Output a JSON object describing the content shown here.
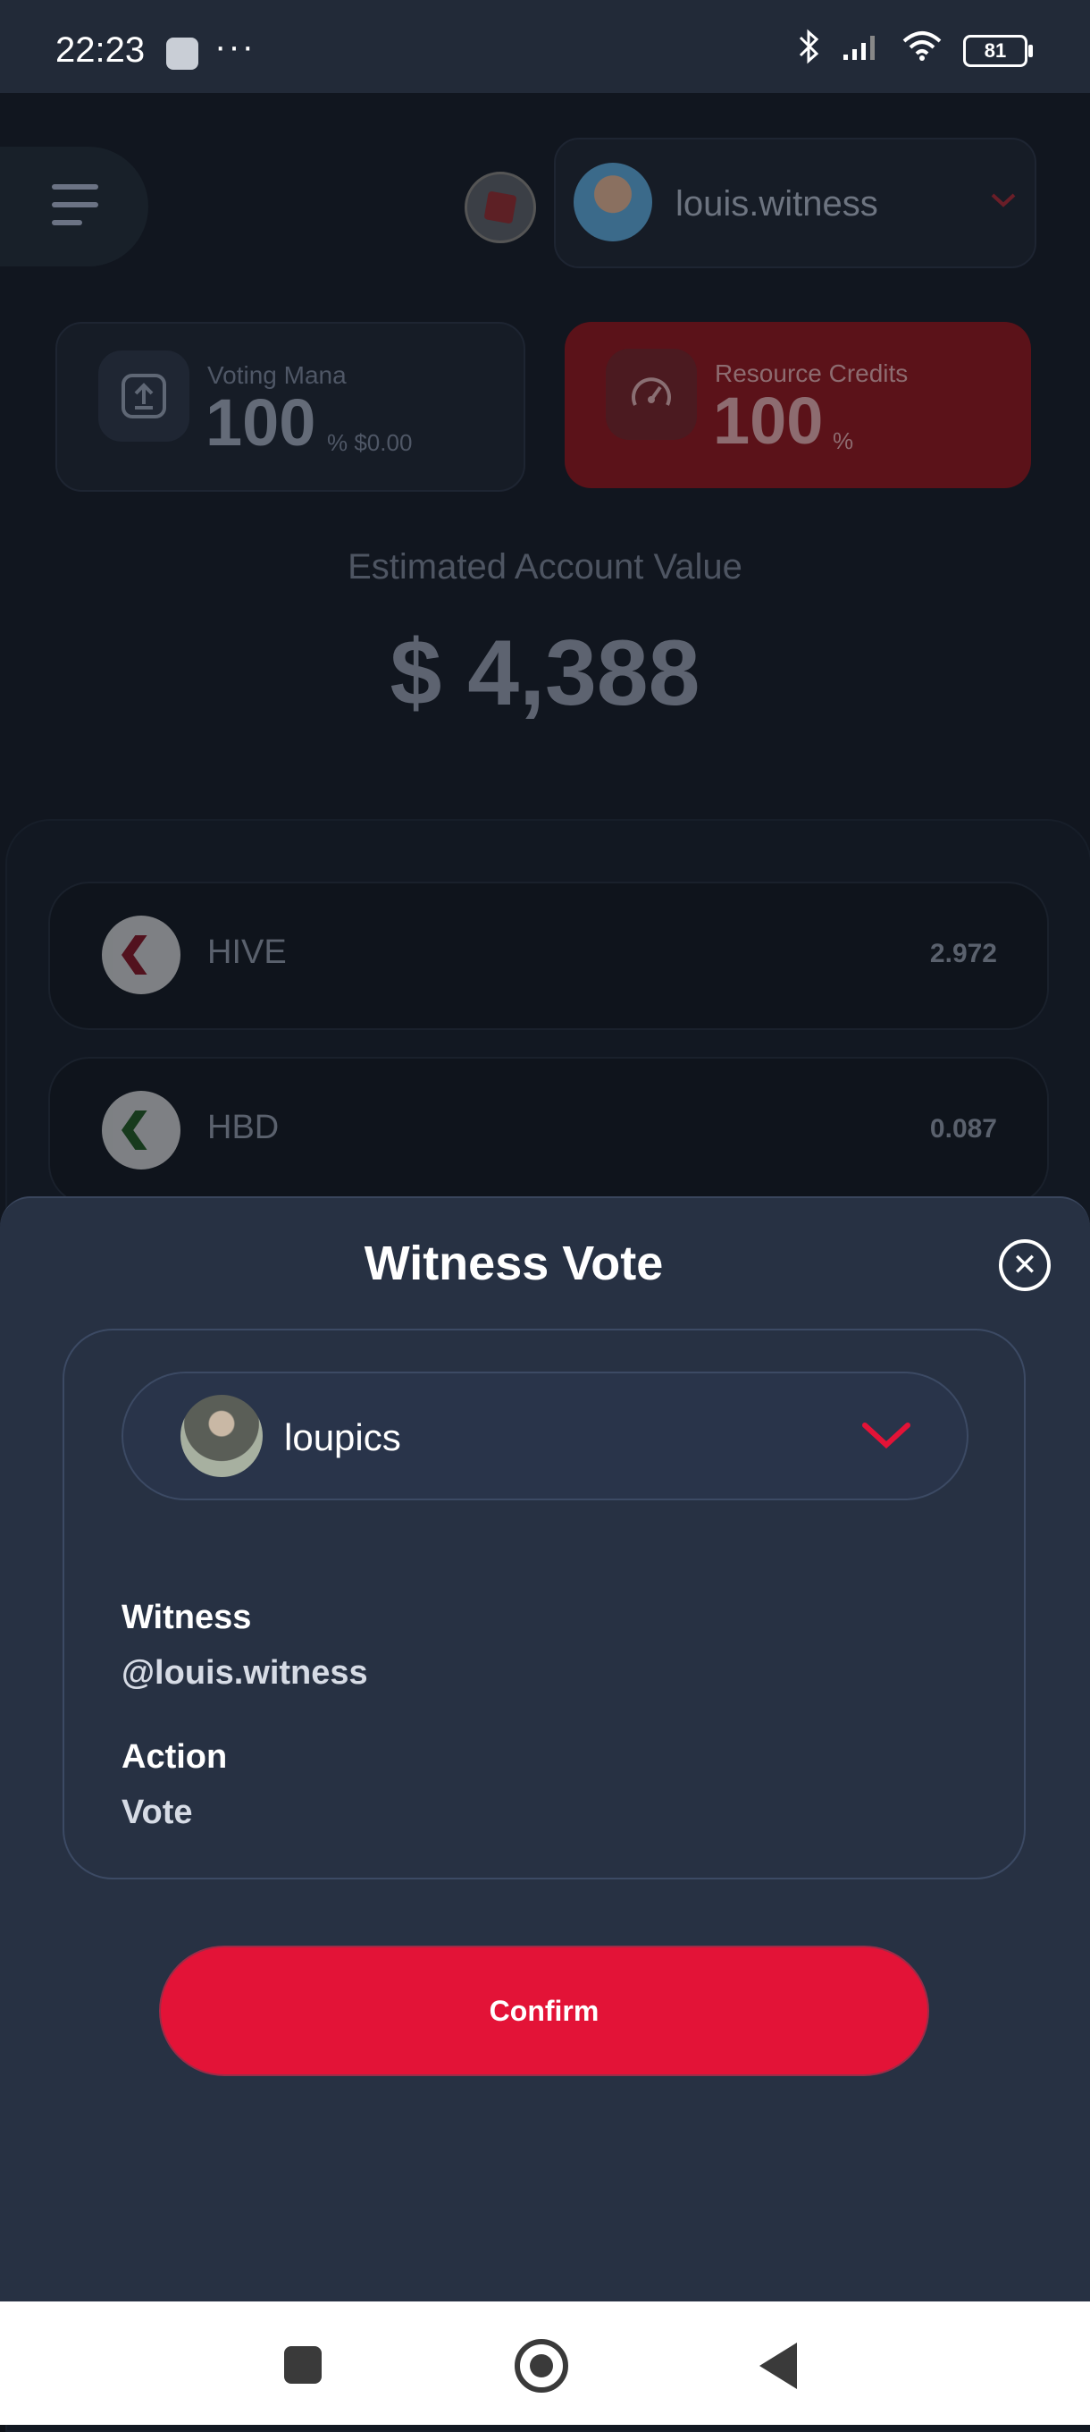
{
  "status_bar": {
    "time": "22:23",
    "more": "···",
    "battery": "81",
    "icons": [
      "bluetooth-icon",
      "signal-icon",
      "wifi-icon",
      "battery-icon"
    ]
  },
  "header": {
    "account_name": "louis.witness"
  },
  "stats": {
    "voting_mana": {
      "label": "Voting Mana",
      "value": "100",
      "unit": "% $0.00"
    },
    "resource_credits": {
      "label": "Resource Credits",
      "value": "100",
      "unit": "%"
    }
  },
  "estimate": {
    "label": "Estimated Account Value",
    "value": "$ 4,388"
  },
  "tokens": [
    {
      "name": "HIVE",
      "amount": "2.972"
    },
    {
      "name": "HBD",
      "amount": "0.087"
    }
  ],
  "modal": {
    "title": "Witness Vote",
    "close": "✕",
    "selected_account": "loupics",
    "witness_label": "Witness",
    "witness_value": "@louis.witness",
    "action_label": "Action",
    "action_value": "Vote",
    "confirm_label": "Confirm"
  },
  "colors": {
    "accent": "#e31337",
    "sheet_bg": "#273143",
    "page_bg": "#11161f"
  }
}
